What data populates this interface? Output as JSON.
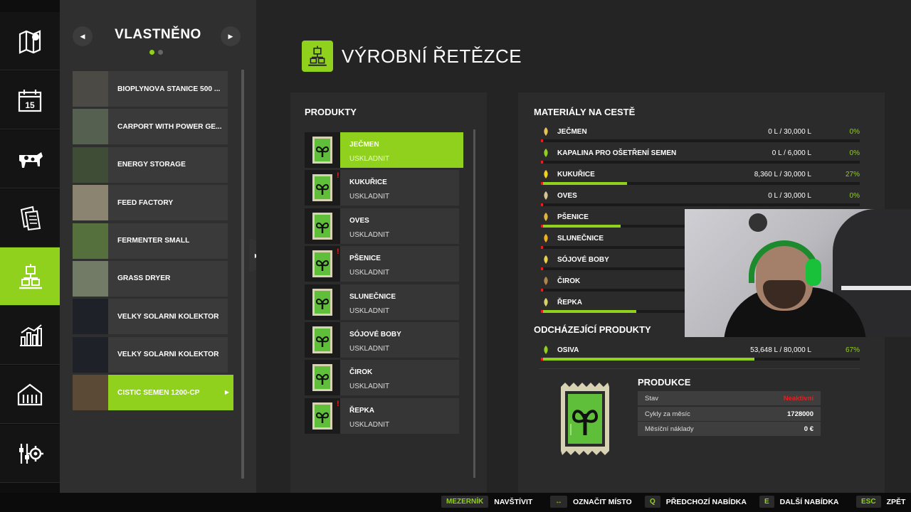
{
  "nav": [
    {
      "icon": "map-icon",
      "active": false
    },
    {
      "icon": "calendar-icon",
      "active": false
    },
    {
      "icon": "cow-icon",
      "active": false
    },
    {
      "icon": "contracts-icon",
      "active": false
    },
    {
      "icon": "production-icon",
      "active": true
    },
    {
      "icon": "statistics-icon",
      "active": false
    },
    {
      "icon": "garage-icon",
      "active": false
    },
    {
      "icon": "settings-icon",
      "active": false
    }
  ],
  "list": {
    "header": "VLASTNĚNO",
    "items": [
      {
        "label": "BIOPLYNOVÁ STANICE 500 ...",
        "thumb": "#4c4a44"
      },
      {
        "label": "CARPORT WITH POWER GE...",
        "thumb": "#566050"
      },
      {
        "label": "ENERGY STORAGE",
        "thumb": "#3f4c36"
      },
      {
        "label": "FEED FACTORY",
        "thumb": "#8a8470"
      },
      {
        "label": "FERMENTER SMALL",
        "thumb": "#55703c"
      },
      {
        "label": "GRASS DRYER",
        "thumb": "#717b66"
      },
      {
        "label": "VELKÝ SOLÁRNÍ KOLEKTOR",
        "thumb": "#1e2228"
      },
      {
        "label": "VELKÝ SOLÁRNÍ KOLEKTOR",
        "thumb": "#1e2228"
      },
      {
        "label": "ČISTIČ SEMEN 1200-CP",
        "thumb": "#5b4a36",
        "selected": true
      }
    ]
  },
  "title": "VÝROBNÍ ŘETĚZCE",
  "products": {
    "header": "PRODUKTY",
    "items": [
      {
        "name": "JEČMEN",
        "status": "USKLADNIT",
        "selected": true,
        "warn": false
      },
      {
        "name": "KUKUŘICE",
        "status": "USKLADNIT",
        "selected": false,
        "warn": true
      },
      {
        "name": "OVES",
        "status": "USKLADNIT",
        "selected": false,
        "warn": false
      },
      {
        "name": "PŠENICE",
        "status": "USKLADNIT",
        "selected": false,
        "warn": true
      },
      {
        "name": "SLUNEČNICE",
        "status": "USKLADNIT",
        "selected": false,
        "warn": false
      },
      {
        "name": "SÓJOVÉ BOBY",
        "status": "USKLADNIT",
        "selected": false,
        "warn": false
      },
      {
        "name": "ČIROK",
        "status": "USKLADNIT",
        "selected": false,
        "warn": false
      },
      {
        "name": "ŘEPKA",
        "status": "USKLADNIT",
        "selected": false,
        "warn": true
      }
    ]
  },
  "materials": {
    "header": "MATERIÁLY NA CESTĚ",
    "items": [
      {
        "name": "JEČMEN",
        "amount": "0 L / 30,000 L",
        "percent": "0%",
        "fill": 0,
        "color": "#e7c35a"
      },
      {
        "name": "KAPALINA PRO OŠETŘENÍ SEMEN",
        "amount": "0 L / 6,000 L",
        "percent": "0%",
        "fill": 0,
        "color": "#8fd11c"
      },
      {
        "name": "KUKUŘICE",
        "amount": "8,360 L / 30,000 L",
        "percent": "27%",
        "fill": 0.27,
        "color": "#f2d21c"
      },
      {
        "name": "OVES",
        "amount": "0 L / 30,000 L",
        "percent": "0%",
        "fill": 0,
        "color": "#d8c490"
      },
      {
        "name": "PŠENICE",
        "amount": "",
        "percent": "",
        "fill": 0.25,
        "color": "#e0b33c"
      },
      {
        "name": "SLUNEČNICE",
        "amount": "",
        "percent": "",
        "fill": 0,
        "color": "#f2b01c"
      },
      {
        "name": "SÓJOVÉ BOBY",
        "amount": "",
        "percent": "",
        "fill": 0,
        "color": "#e8d24a"
      },
      {
        "name": "ČIROK",
        "amount": "",
        "percent": "",
        "fill": 0,
        "color": "#b0874a"
      },
      {
        "name": "ŘEPKA",
        "amount": "",
        "percent": "",
        "fill": 0.3,
        "color": "#d8d06a"
      }
    ]
  },
  "outgoing": {
    "header": "ODCHÁZEJÍCÍ PRODUKTY",
    "items": [
      {
        "name": "OSIVA",
        "amount": "53,648 L / 80,000 L",
        "percent": "67%",
        "fill": 0.67,
        "color": "#8fd11c"
      }
    ]
  },
  "production": {
    "header": "PRODUKCE",
    "rows": [
      {
        "key": "Stav",
        "value": "Neaktivní",
        "red": true
      },
      {
        "key": "Cykly za měsíc",
        "value": "1728000",
        "red": false
      },
      {
        "key": "Měsíční náklady",
        "value": "0 €",
        "red": false
      }
    ]
  },
  "hints": [
    {
      "key": "MEZERNÍK",
      "label": "NAVŠTÍVIT"
    },
    {
      "key": "↔",
      "label": "OZNAČIT MÍSTO"
    },
    {
      "key": "Q",
      "label": "PŘEDCHOZÍ NABÍDKA"
    },
    {
      "key": "E",
      "label": "DALŠÍ NABÍDKA"
    },
    {
      "key": "ESC",
      "label": "ZPĚT"
    }
  ],
  "colors": {
    "accent": "#8fd11c",
    "warning": "#e32020"
  }
}
